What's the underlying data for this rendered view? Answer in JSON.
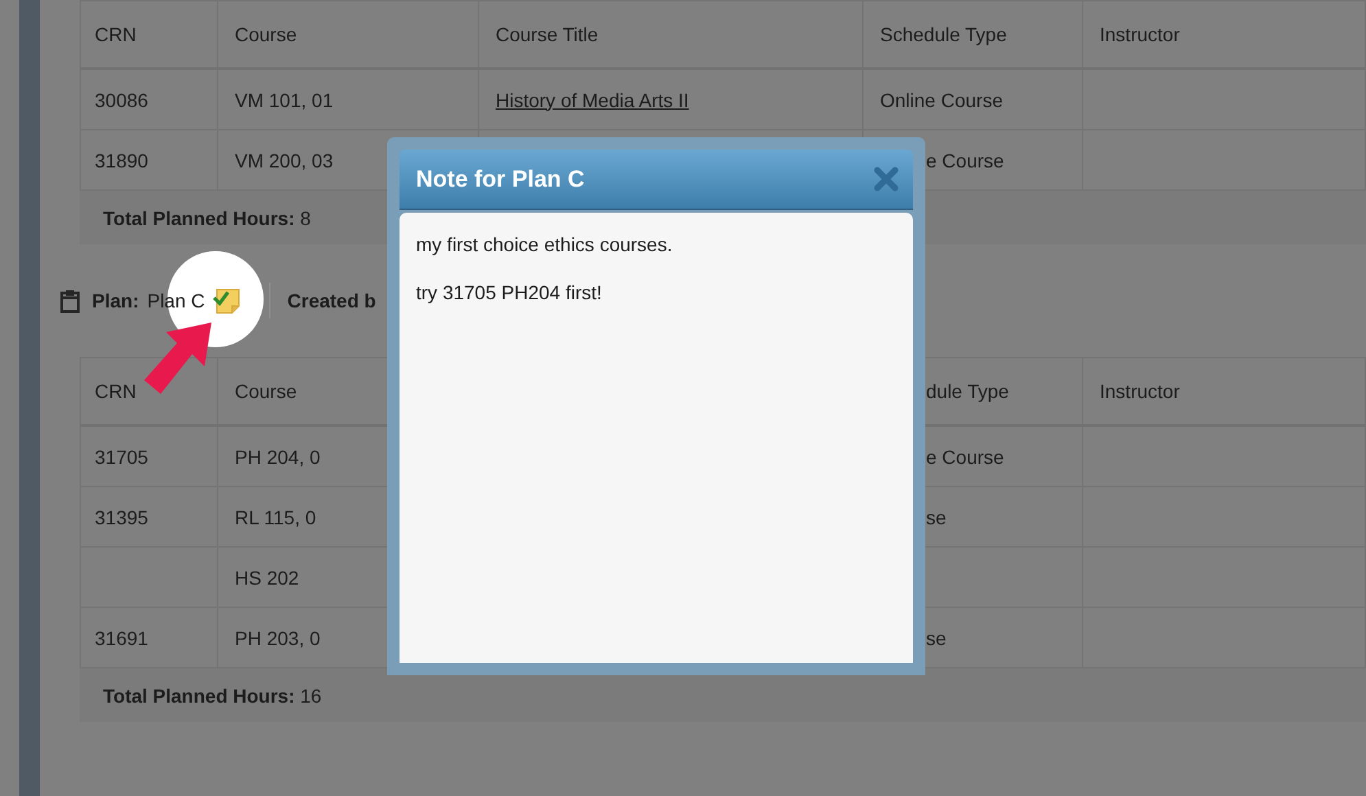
{
  "plans": [
    {
      "table": {
        "columns": [
          {
            "label": "CRN"
          },
          {
            "label": "Course"
          },
          {
            "label": "Course Title"
          },
          {
            "label": "Schedule Type"
          },
          {
            "label": "Instructor"
          }
        ],
        "rows": [
          [
            "30086",
            "VM 101, 01",
            {
              "text": "History of Media Arts II",
              "kind": "link"
            },
            "Online Course",
            null
          ],
          [
            "31890",
            "VM 200, 03",
            null,
            "e Course",
            null
          ]
        ]
      },
      "total": {
        "label": "Total Planned Hours:",
        "value": "8"
      }
    },
    {
      "header": {
        "label": "Plan:",
        "value": "Plan C",
        "created_label": "Created b"
      },
      "table": {
        "columns": [
          {
            "label": "CRN"
          },
          {
            "label": "Course"
          },
          {},
          {
            "label": "dule Type"
          },
          {
            "label": "Instructor"
          }
        ],
        "rows": [
          [
            "31705",
            "PH 204, 0",
            null,
            "e Course",
            null
          ],
          [
            "31395",
            "RL 115, 0",
            null,
            "se",
            null
          ],
          [
            null,
            "HS 202",
            null,
            null,
            null
          ],
          [
            "31691",
            "PH 203, 0",
            null,
            "se",
            null
          ]
        ]
      },
      "total": {
        "label": "Total Planned Hours:",
        "value": "16"
      }
    }
  ],
  "dialog": {
    "title": "Note for Plan C",
    "paragraphs": [
      "my first choice ethics courses.",
      "try 31705 PH204 first!"
    ]
  }
}
